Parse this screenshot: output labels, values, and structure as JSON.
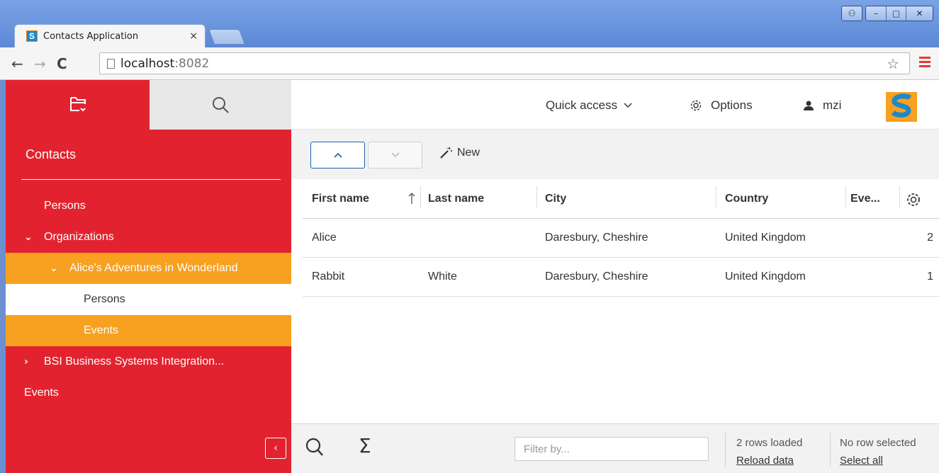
{
  "browser": {
    "tab_title": "Contacts Application",
    "tab_close": "×",
    "url_host": "localhost",
    "url_port": ":8082"
  },
  "sidebar": {
    "title": "Contacts",
    "tree": [
      {
        "label": "Persons",
        "level": 0
      },
      {
        "label": "Organizations",
        "level": 0,
        "expanded": true
      },
      {
        "label": "Alice's Adventures in Wonderland",
        "level": 1,
        "expanded": true
      },
      {
        "label": "Persons",
        "level": 2
      },
      {
        "label": "Events",
        "level": 2,
        "selected": true
      },
      {
        "label": "BSI Business Systems Integration...",
        "level": 1,
        "expanded": false
      },
      {
        "label": "Events",
        "level": 0
      }
    ],
    "collapse_label": "‹"
  },
  "header": {
    "quick_access": "Quick access",
    "options": "Options",
    "user": "mzi"
  },
  "toolbar": {
    "new_label": "New"
  },
  "grid": {
    "columns": [
      "First name",
      "Last name",
      "City",
      "Country",
      "Eve..."
    ],
    "rows": [
      [
        "Alice",
        "",
        "Daresbury, Cheshire",
        "United Kingdom",
        "2"
      ],
      [
        "Rabbit",
        "White",
        "Daresbury, Cheshire",
        "United Kingdom",
        "1"
      ]
    ]
  },
  "footer": {
    "filter_placeholder": "Filter by...",
    "rows_loaded": "2 rows loaded",
    "reload": "Reload data",
    "selection": "No row selected",
    "select_all": "Select all"
  },
  "colors": {
    "brand_red": "#e2232f",
    "brand_orange": "#f8a020",
    "accent_blue": "#1a5fa6"
  }
}
